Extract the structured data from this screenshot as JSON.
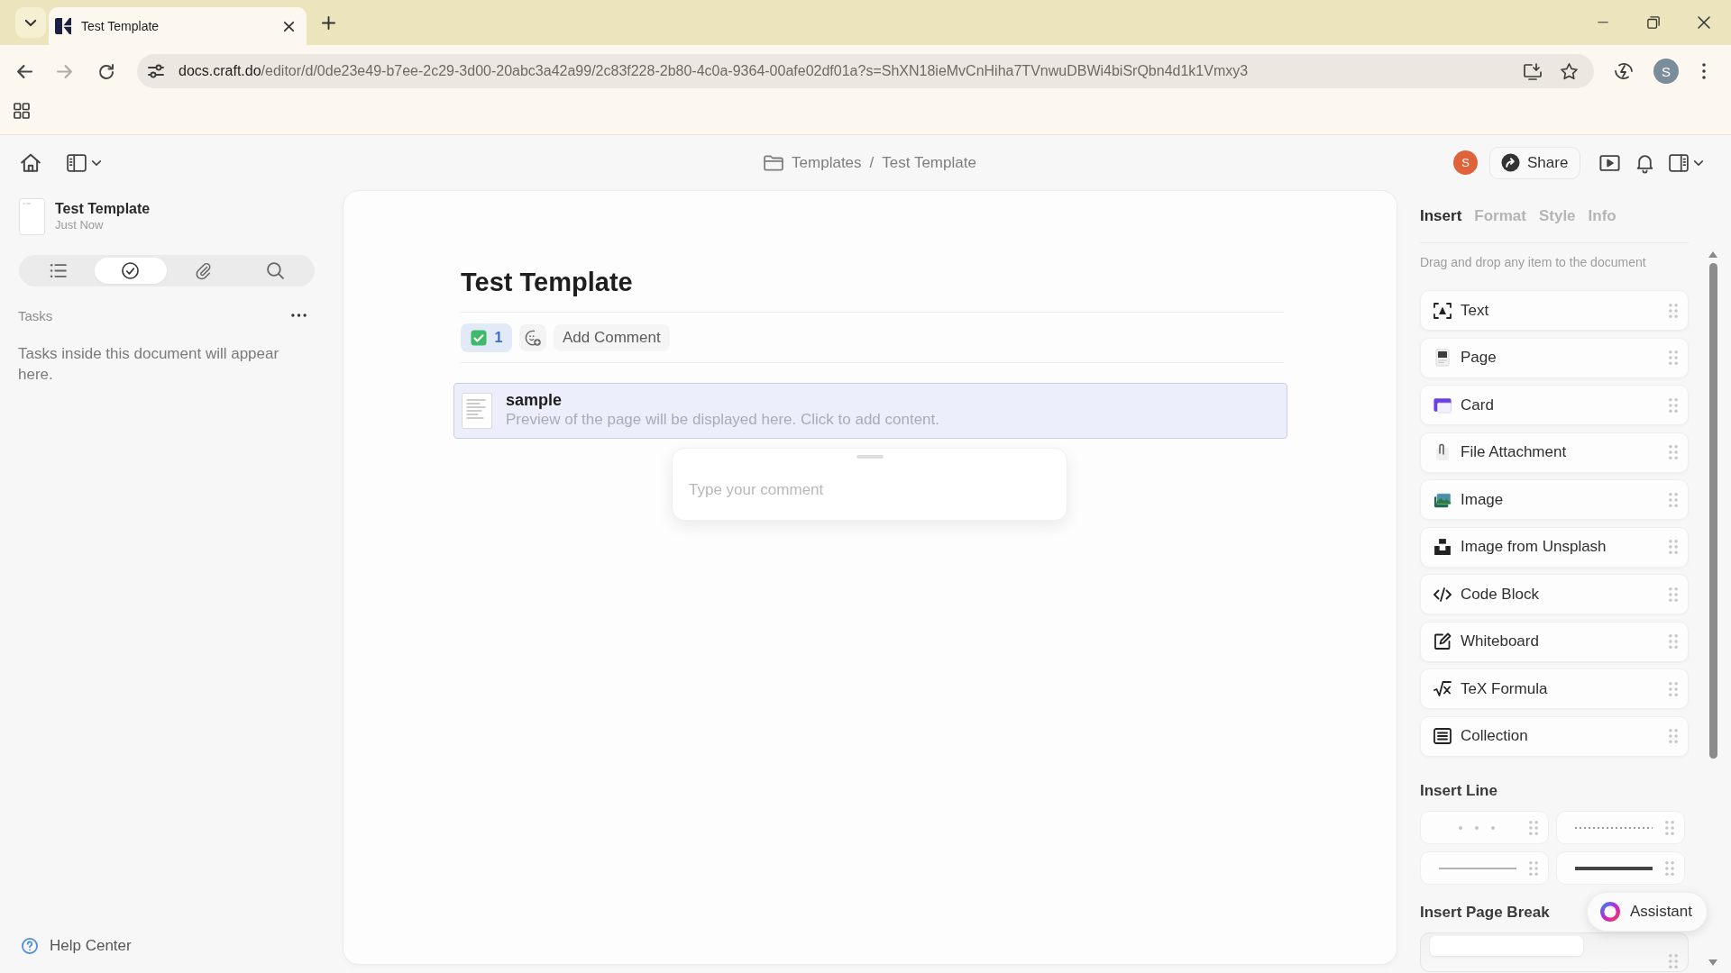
{
  "browser": {
    "tabs": [
      {
        "title": "Test Template",
        "selected": true
      }
    ],
    "address": {
      "host": "docs.craft.do",
      "path": "/editor/d/0de23e49-b7ee-2c29-3d00-20abc3a42a99/2c83f228-2b80-4c0a-9364-00afe02df01a?s=ShXN18ieMvCnHiha7TVnwuDBWi4biSrQbn4d1k1Vmxy3"
    },
    "profile_initial": "S"
  },
  "header": {
    "breadcrumb": [
      {
        "label": "Templates"
      },
      {
        "label": "Test Template"
      }
    ],
    "separator": "/",
    "user_initial": "S",
    "share_label": "Share"
  },
  "sidebar": {
    "document": {
      "title": "Test Template",
      "edited": "Just Now"
    },
    "view_tabs": [
      {
        "kind": "outline",
        "selected": false
      },
      {
        "kind": "tasks",
        "selected": true
      },
      {
        "kind": "attachments",
        "selected": false
      },
      {
        "kind": "search",
        "selected": false
      }
    ],
    "section_title": "Tasks",
    "empty_message": "Tasks inside this document will appear here.",
    "help_link": "Help Center"
  },
  "document": {
    "title": "Test Template",
    "task_count": "1",
    "add_comment_label": "Add Comment",
    "page_block": {
      "title": "sample",
      "preview": "Preview of the page will be displayed here. Click to add content.",
      "selected": true
    },
    "comment_popover": {
      "placeholder": "Type your comment"
    }
  },
  "panel": {
    "tabs": [
      {
        "label": "Insert",
        "selected": true
      },
      {
        "label": "Format",
        "selected": false
      },
      {
        "label": "Style",
        "selected": false
      },
      {
        "label": "Info",
        "selected": false
      }
    ],
    "hint": "Drag and drop any item to the document",
    "items": [
      {
        "label": "Text",
        "kind": "text"
      },
      {
        "label": "Page",
        "kind": "page"
      },
      {
        "label": "Card",
        "kind": "card"
      },
      {
        "label": "File Attachment",
        "kind": "file"
      },
      {
        "label": "Image",
        "kind": "image"
      },
      {
        "label": "Image from Unsplash",
        "kind": "unsplash"
      },
      {
        "label": "Code Block",
        "kind": "code"
      },
      {
        "label": "Whiteboard",
        "kind": "whiteboard"
      },
      {
        "label": "TeX Formula",
        "kind": "formula"
      },
      {
        "label": "Collection",
        "kind": "collection"
      }
    ],
    "line_section": {
      "title": "Insert Line",
      "options": [
        {
          "kind": "dots"
        },
        {
          "kind": "dotted"
        },
        {
          "kind": "thin"
        },
        {
          "kind": "thick"
        }
      ]
    },
    "page_break_section": {
      "title": "Insert Page Break"
    },
    "assistant_label": "Assistant"
  }
}
